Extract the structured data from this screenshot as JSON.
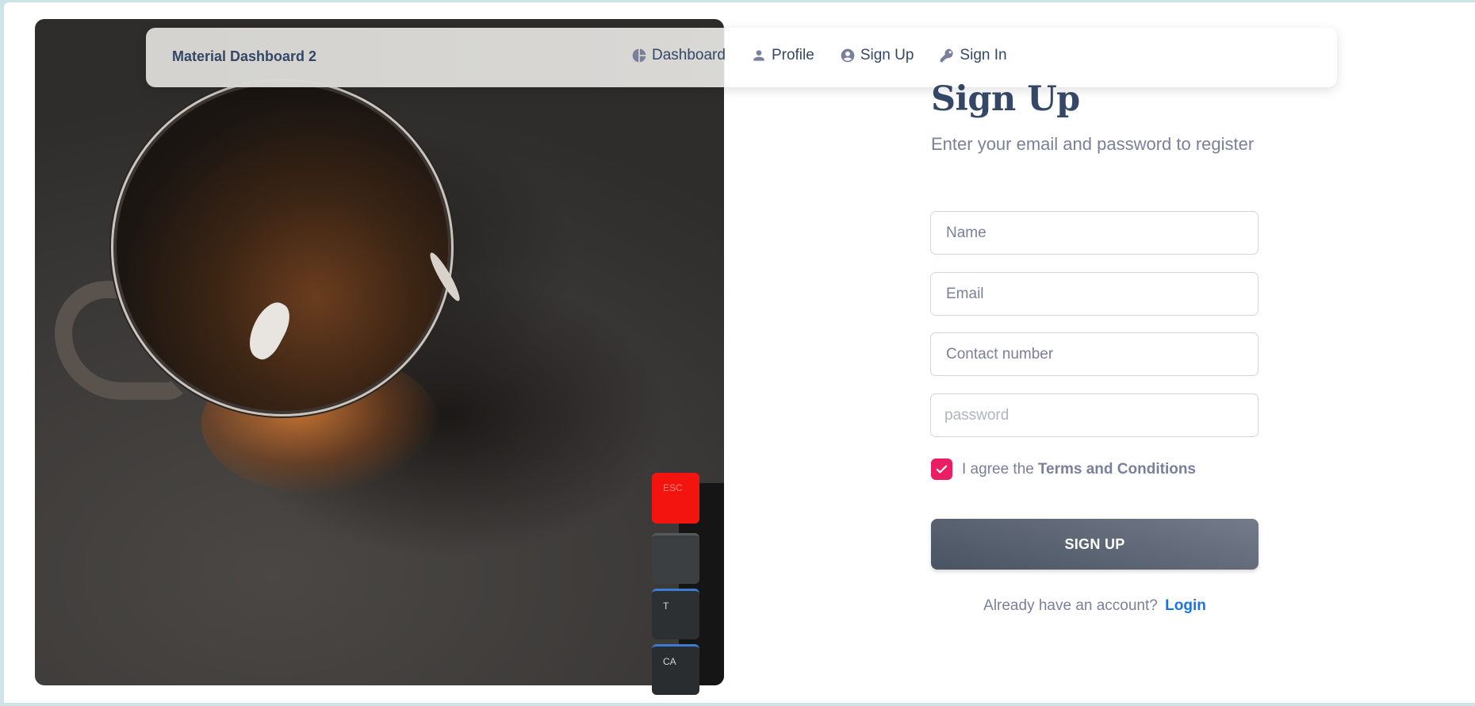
{
  "navbar": {
    "brand": "Material Dashboard 2",
    "links": [
      {
        "label": "Dashboard",
        "icon": "pie-chart-icon"
      },
      {
        "label": "Profile",
        "icon": "person-icon"
      },
      {
        "label": "Sign Up",
        "icon": "account-circle-icon"
      },
      {
        "label": "Sign In",
        "icon": "key-icon"
      }
    ]
  },
  "hero_image": {
    "keycap_labels": [
      "ESC",
      "",
      "T",
      "CA"
    ]
  },
  "form": {
    "title": "Sign Up",
    "subtitle": "Enter your email and password to register",
    "fields": {
      "name_placeholder": "Name",
      "email_placeholder": "Email",
      "contact_placeholder": "Contact number",
      "password_placeholder": "password"
    },
    "agree_text": "I agree the",
    "terms_label": "Terms and Conditions",
    "terms_checked": true,
    "submit_label": "SIGN UP",
    "account_text": "Already have an account?",
    "login_label": "Login"
  },
  "colors": {
    "primary_text": "#344767",
    "secondary_text": "#7b809a",
    "checkbox": "#e91e63",
    "link": "#1a73e8",
    "button": "#495361"
  }
}
